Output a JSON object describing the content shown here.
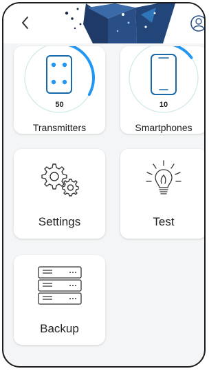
{
  "header": {
    "back_icon": "chevron-left-icon",
    "user_icon": "user-account-icon"
  },
  "tiles": [
    {
      "label": "Transmitters",
      "count": "50",
      "icon": "transmitter-icon",
      "gauge_fraction": 0.33
    },
    {
      "label": "Smartphones",
      "count": "10",
      "icon": "smartphone-icon",
      "gauge_fraction": 0.15
    },
    {
      "label": "Settings",
      "icon": "gears-icon"
    },
    {
      "label": "Test",
      "icon": "lightbulb-icon"
    },
    {
      "label": "Backup",
      "icon": "server-stack-icon"
    }
  ],
  "colors": {
    "accent": "#2196f3",
    "gauge_ring": "#cfe8e8",
    "icon_outline": "#1769aa"
  }
}
